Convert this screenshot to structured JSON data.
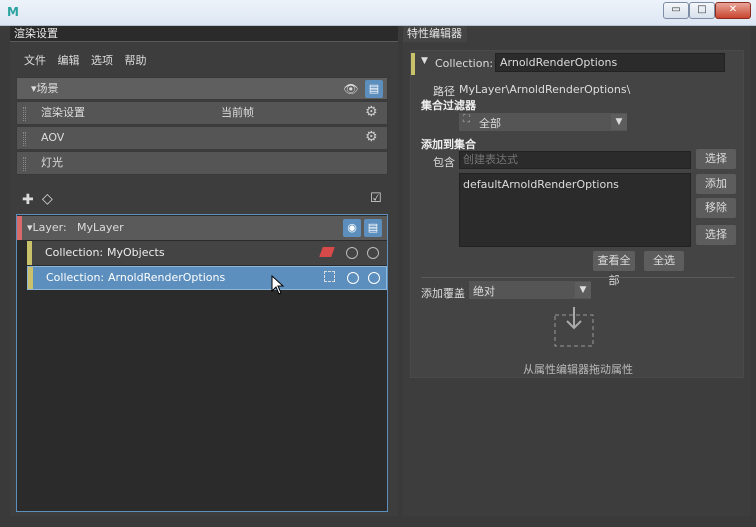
{
  "window": {
    "min_label": "▭",
    "max_label": "□",
    "close_label": "✕"
  },
  "left_panel": {
    "tab_title": "渲染设置",
    "menu": [
      "文件",
      "编辑",
      "选项",
      "帮助"
    ],
    "scene": {
      "header": "▾场景",
      "rows": [
        {
          "label": "渲染设置",
          "value": "当前帧"
        },
        {
          "label": "AOV",
          "value": ""
        },
        {
          "label": "灯光",
          "value": ""
        }
      ]
    },
    "layer": {
      "label": "▾Layer:",
      "name": "MyLayer",
      "collections": [
        {
          "prefix": "Collection:",
          "name": "MyObjects",
          "selected": false
        },
        {
          "prefix": "Collection:",
          "name": "ArnoldRenderOptions",
          "selected": true
        }
      ]
    }
  },
  "right_panel": {
    "tab_title": "特性编辑器",
    "collection_label": "Collection:",
    "collection_value": "ArnoldRenderOptions",
    "path_label": "路径",
    "path_value": "MyLayer\\ArnoldRenderOptions\\",
    "filter_label": "集合过滤器",
    "filter_value": "全部",
    "add_to_collection_label": "添加到集合",
    "include_label": "包含",
    "expression_placeholder": "创建表达式",
    "list_items": [
      "defaultArnoldRenderOptions"
    ],
    "btn_select": "选择",
    "btn_add": "添加",
    "btn_remove": "移除",
    "btn_select2": "选择",
    "btn_view_all": "查看全部",
    "btn_select_all": "全选",
    "add_override_label": "添加覆盖",
    "override_value": "绝对",
    "drop_hint": "从属性编辑器拖动属性"
  }
}
